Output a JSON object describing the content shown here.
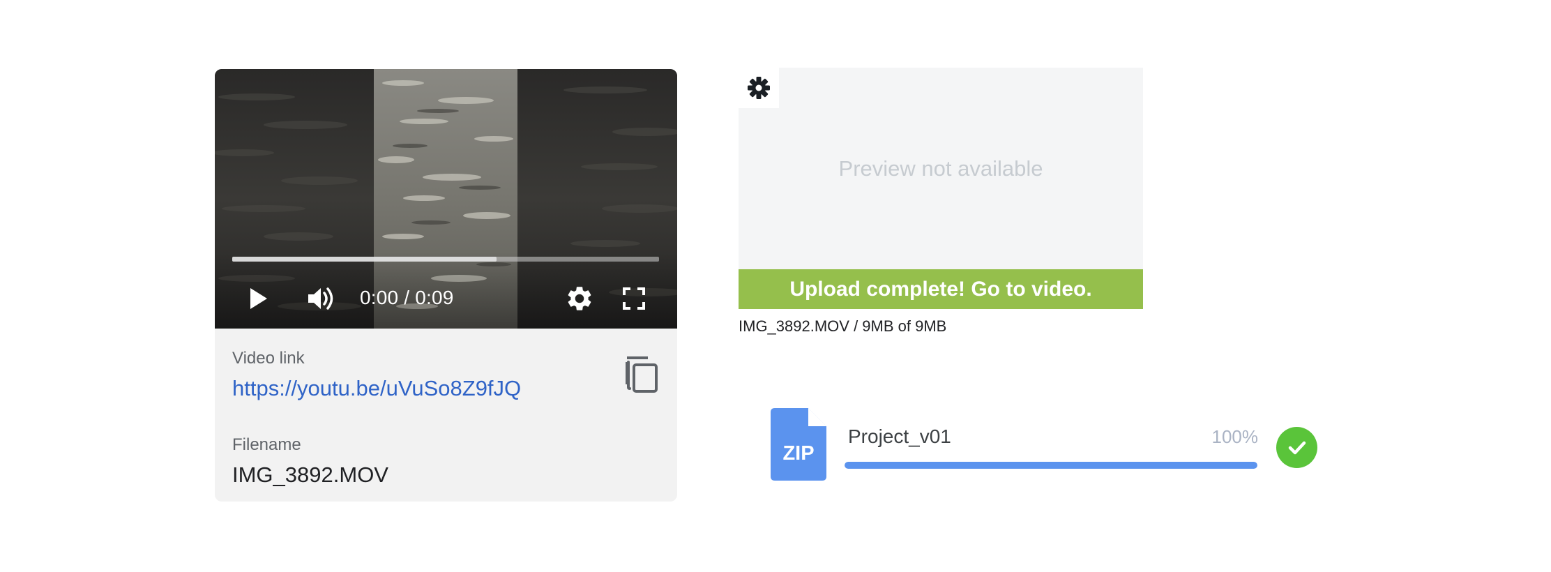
{
  "player": {
    "time_display": "0:00 / 0:09",
    "buffered_fraction": 0.62,
    "icons": {
      "play": "play-icon",
      "volume": "volume-icon",
      "settings": "gear-icon",
      "fullscreen": "fullscreen-icon"
    }
  },
  "details": {
    "video_link_label": "Video link",
    "video_link_url": "https://youtu.be/uVuSo8Z9fJQ",
    "filename_label": "Filename",
    "filename_value": "IMG_3892.MOV",
    "copy_icon": "copy-icon"
  },
  "upload": {
    "settings_icon": "asterisk-gear-icon",
    "preview_text": "Preview not available",
    "banner_text": "Upload complete! Go to video.",
    "status_text": "IMG_3892.MOV / 9MB of 9MB",
    "banner_color": "#95bf4c"
  },
  "zip_upload": {
    "icon_label": "ZIP",
    "name": "Project_v01",
    "percent_text": "100%",
    "progress_fraction": 1.0,
    "accent_color": "#5b93ee",
    "success_color": "#5ac43a",
    "status_icon": "check-icon"
  }
}
